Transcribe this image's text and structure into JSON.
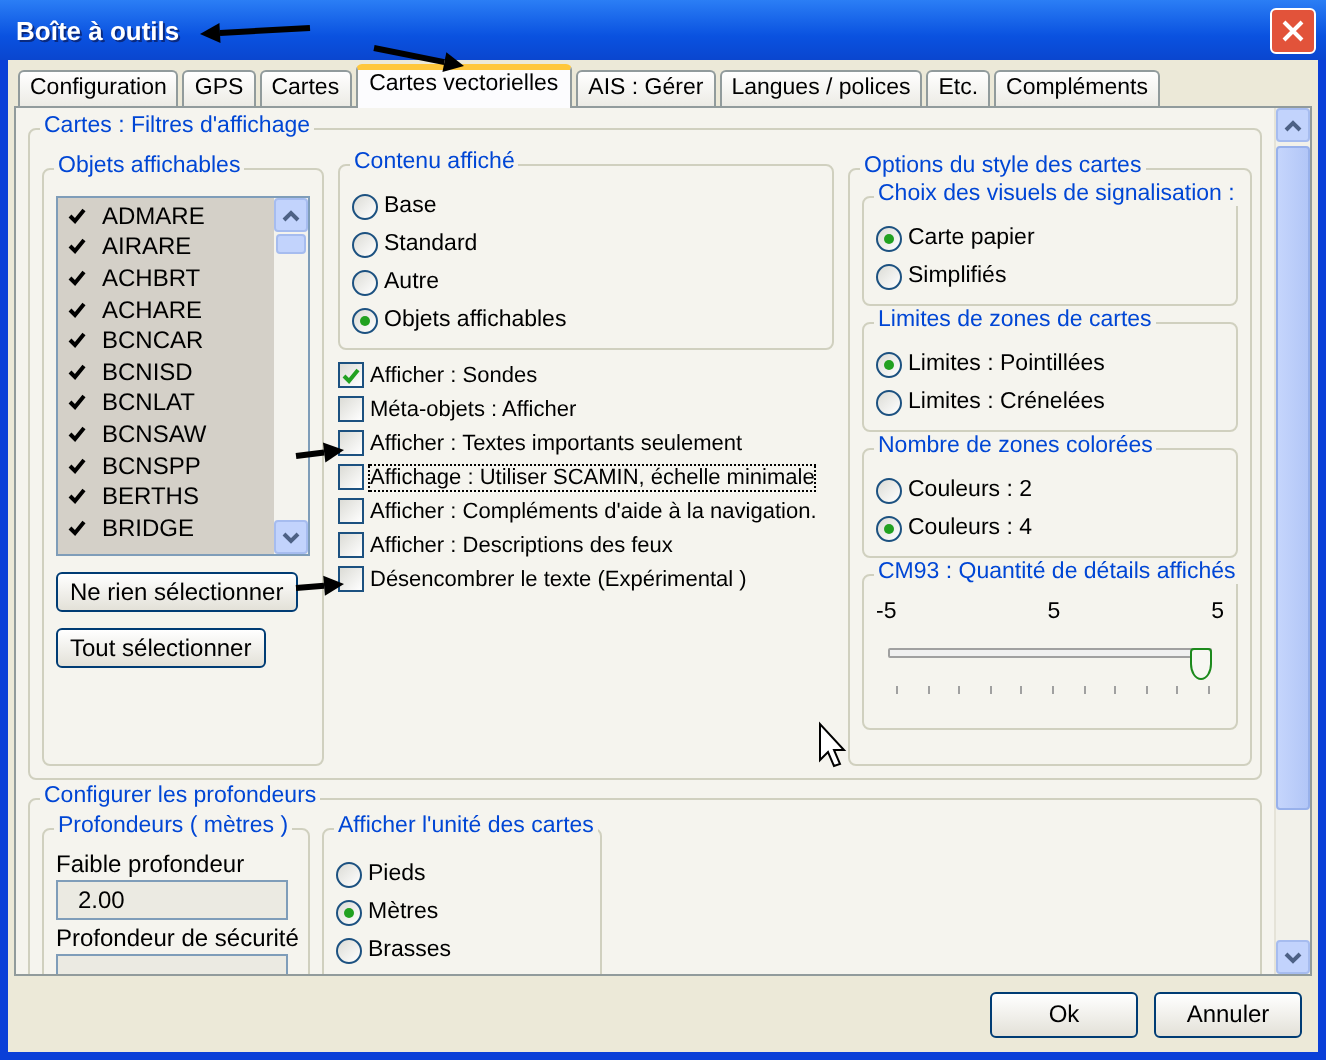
{
  "window": {
    "title": "Boîte à outils"
  },
  "tabs": [
    {
      "label": "Configuration",
      "selected": false
    },
    {
      "label": "GPS",
      "selected": false
    },
    {
      "label": "Cartes",
      "selected": false
    },
    {
      "label": "Cartes vectorielles",
      "selected": true
    },
    {
      "label": "AIS : Gérer",
      "selected": false
    },
    {
      "label": "Langues / polices",
      "selected": false
    },
    {
      "label": "Etc.",
      "selected": false
    },
    {
      "label": "Compléments",
      "selected": false
    }
  ],
  "filters": {
    "title": "Cartes : Filtres d'affichage",
    "objects": {
      "title": "Objets affichables",
      "items": [
        {
          "label": "ADMARE",
          "checked": true
        },
        {
          "label": "AIRARE",
          "checked": true
        },
        {
          "label": "ACHBRT",
          "checked": true
        },
        {
          "label": "ACHARE",
          "checked": true
        },
        {
          "label": "BCNCAR",
          "checked": true
        },
        {
          "label": "BCNISD",
          "checked": true
        },
        {
          "label": "BCNLAT",
          "checked": true
        },
        {
          "label": "BCNSAW",
          "checked": true
        },
        {
          "label": "BCNSPP",
          "checked": true
        },
        {
          "label": "BERTHS",
          "checked": true
        },
        {
          "label": "BRIDGE",
          "checked": true
        }
      ],
      "buttons": [
        "Ne rien sélectionner",
        "Tout sélectionner"
      ]
    },
    "display_content": {
      "title": "Contenu affiché",
      "options": [
        {
          "label": "Base",
          "selected": false
        },
        {
          "label": "Standard",
          "selected": false
        },
        {
          "label": "Autre",
          "selected": false
        },
        {
          "label": "Objets affichables",
          "selected": true
        }
      ]
    },
    "options": [
      {
        "label": "Afficher : Sondes",
        "checked": true,
        "focused": false
      },
      {
        "label": "Méta-objets : Afficher",
        "checked": false,
        "focused": false
      },
      {
        "label": "Afficher : Textes importants seulement",
        "checked": false,
        "focused": false
      },
      {
        "label": "Affichage : Utiliser SCAMIN, échelle minimale",
        "checked": false,
        "focused": true
      },
      {
        "label": "Afficher : Compléments d'aide à la navigation.",
        "checked": false,
        "focused": false
      },
      {
        "label": "Afficher : Descriptions des feux",
        "checked": false,
        "focused": false
      },
      {
        "label": "Désencombrer le texte (Expérimental )",
        "checked": false,
        "focused": false
      }
    ],
    "style": {
      "title": "Options du style des cartes",
      "groups": [
        {
          "title": "Choix des visuels de signalisation :",
          "options": [
            {
              "label": "Carte papier",
              "selected": true
            },
            {
              "label": "Simplifiés",
              "selected": false
            }
          ]
        },
        {
          "title": "Limites de zones de cartes",
          "options": [
            {
              "label": "Limites : Pointillées",
              "selected": true
            },
            {
              "label": "Limites : Crénelées",
              "selected": false
            }
          ]
        },
        {
          "title": "Nombre de zones colorées",
          "options": [
            {
              "label": "Couleurs : 2",
              "selected": false
            },
            {
              "label": "Couleurs : 4",
              "selected": true
            }
          ]
        }
      ],
      "detail": {
        "title": "CM93 : Quantité de détails affichés",
        "scale": [
          "-5",
          "5",
          "5"
        ],
        "level": 1
      }
    }
  },
  "depths": {
    "title": "Configurer les profondeurs",
    "depth_group": {
      "title": "Profondeurs ( mètres )",
      "fields": [
        {
          "label": "Faible profondeur",
          "value": "2.00"
        },
        {
          "label": "Profondeur de sécurité"
        }
      ]
    },
    "units": {
      "title": "Afficher l'unité des cartes",
      "options": [
        {
          "label": "Pieds",
          "selected": false
        },
        {
          "label": "Mètres",
          "selected": true
        },
        {
          "label": "Brasses",
          "selected": false
        }
      ]
    }
  },
  "buttons": [
    "Ok",
    "Annuler"
  ]
}
